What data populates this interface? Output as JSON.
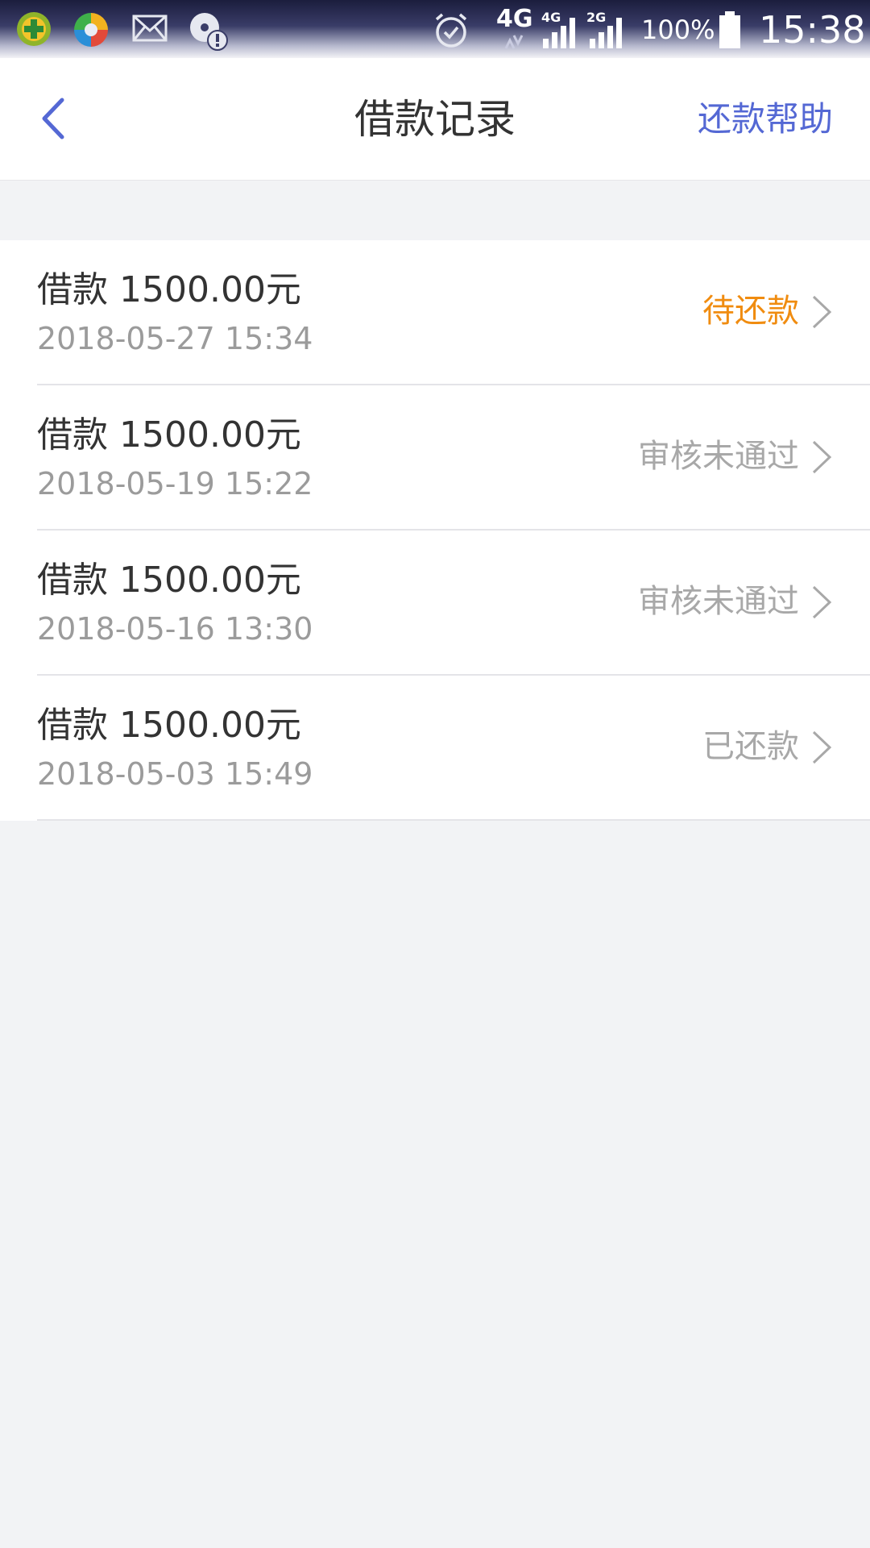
{
  "status_bar": {
    "network_label": "4G",
    "sim1_label": "4G",
    "sim2_label": "2G",
    "battery": "100%",
    "time": "15:38",
    "icons": [
      "360-security-icon",
      "browser-icon",
      "mail-icon",
      "notification-alert-icon",
      "alarm-icon",
      "signal-icon",
      "battery-icon"
    ]
  },
  "header": {
    "title": "借款记录",
    "help_label": "还款帮助",
    "back_icon": "chevron-left-icon"
  },
  "colors": {
    "accent": "#5468d4",
    "pending": "#f08c10",
    "muted": "#a8a8a8",
    "background": "#f2f3f5"
  },
  "records": [
    {
      "amount": "借款 1500.00元",
      "date": "2018-05-27 15:34",
      "status": "待还款",
      "status_type": "pending"
    },
    {
      "amount": "借款 1500.00元",
      "date": "2018-05-19 15:22",
      "status": "审核未通过",
      "status_type": "rejected"
    },
    {
      "amount": "借款 1500.00元",
      "date": "2018-05-16 13:30",
      "status": "审核未通过",
      "status_type": "rejected"
    },
    {
      "amount": "借款 1500.00元",
      "date": "2018-05-03 15:49",
      "status": "已还款",
      "status_type": "repaid"
    }
  ]
}
